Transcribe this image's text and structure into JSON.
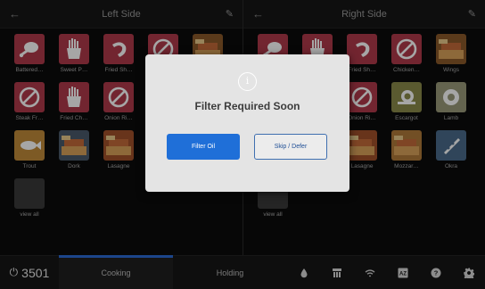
{
  "left_pane": {
    "title": "Left Side",
    "items": [
      {
        "label": "Battered…",
        "kind": "drumstick",
        "color": "#b03a4a"
      },
      {
        "label": "Sweet P…",
        "kind": "fries",
        "color": "#b03a4a"
      },
      {
        "label": "Fried Sh…",
        "kind": "shrimp",
        "color": "#b03a4a"
      },
      {
        "label": "",
        "kind": "disabled",
        "color": "#b03a4a"
      },
      {
        "label": "",
        "kind": "photo",
        "color": "#8a5a2a"
      },
      {
        "label": "Steak Fr…",
        "kind": "disabled",
        "color": "#b03a4a"
      },
      {
        "label": "Fried Ch…",
        "kind": "fries",
        "color": "#b03a4a"
      },
      {
        "label": "Onion Ri…",
        "kind": "disabled",
        "color": "#b03a4a"
      },
      {
        "label": "",
        "kind": "none",
        "color": "#000000"
      },
      {
        "label": "",
        "kind": "none",
        "color": "#000000"
      },
      {
        "label": "Trout",
        "kind": "fish",
        "color": "#c08a3a"
      },
      {
        "label": "Dork",
        "kind": "photo",
        "color": "#4a5a6a"
      },
      {
        "label": "Lasagne",
        "kind": "photo",
        "color": "#a0502a"
      },
      {
        "label": "",
        "kind": "none",
        "color": "#000000"
      },
      {
        "label": "",
        "kind": "none",
        "color": "#000000"
      },
      {
        "label": "view all",
        "kind": "blank",
        "color": "#3a3a3a"
      }
    ]
  },
  "right_pane": {
    "title": "Right Side",
    "items": [
      {
        "label": "",
        "kind": "drumstick",
        "color": "#b03a4a"
      },
      {
        "label": "",
        "kind": "fries",
        "color": "#b03a4a"
      },
      {
        "label": "Fried Sh…",
        "kind": "shrimp",
        "color": "#b03a4a"
      },
      {
        "label": "Chicken…",
        "kind": "disabled",
        "color": "#b03a4a"
      },
      {
        "label": "Wings",
        "kind": "photo",
        "color": "#8a5a2a"
      },
      {
        "label": "",
        "kind": "none",
        "color": "#000000"
      },
      {
        "label": "",
        "kind": "none",
        "color": "#000000"
      },
      {
        "label": "Onion Ri…",
        "kind": "disabled",
        "color": "#b03a4a"
      },
      {
        "label": "Escargot",
        "kind": "escargot",
        "color": "#8a8a4a"
      },
      {
        "label": "Lamb",
        "kind": "lamb",
        "color": "#9a9a7a"
      },
      {
        "label": "",
        "kind": "none",
        "color": "#000000"
      },
      {
        "label": "",
        "kind": "none",
        "color": "#000000"
      },
      {
        "label": "Lasagne",
        "kind": "photo",
        "color": "#a0502a"
      },
      {
        "label": "Mozzar…",
        "kind": "photo",
        "color": "#b07a3a"
      },
      {
        "label": "Okra",
        "kind": "okra",
        "color": "#4a6a8a"
      },
      {
        "label": "view all",
        "kind": "blank",
        "color": "#3a3a3a"
      }
    ]
  },
  "footer": {
    "store_number": "3501",
    "tabs": [
      {
        "label": "Cooking",
        "active": true
      },
      {
        "label": "Holding",
        "active": false
      }
    ],
    "icons": [
      "oil-drop-icon",
      "fryer-icon",
      "wifi-icon",
      "az-icon",
      "help-icon",
      "settings-icon"
    ]
  },
  "dialog": {
    "icon": "info-icon",
    "message": "Filter Required Soon",
    "primary_label": "Filter Oil",
    "secondary_label": "Skip / Defer"
  }
}
